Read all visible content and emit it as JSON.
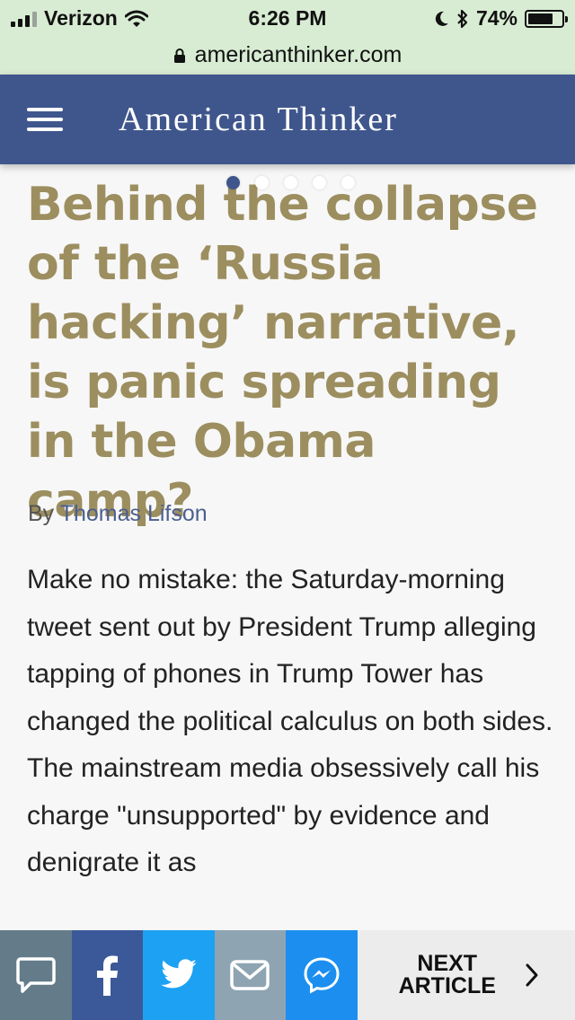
{
  "status_bar": {
    "carrier": "Verizon",
    "time": "6:26 PM",
    "battery_percent": "74%",
    "battery_level": 0.74
  },
  "url_bar": {
    "domain": "americanthinker.com"
  },
  "header": {
    "site_title": "American Thinker"
  },
  "carousel": {
    "dot_count": 5,
    "active_index": 0
  },
  "article": {
    "headline": "Behind the collapse of the ‘Russia hacking’ narrative, is panic spreading in the Obama camp?",
    "byline_prefix": "By",
    "author": "Thomas Lifson",
    "body": "Make no mistake: the Saturday-morning tweet sent out by President Trump alleging tapping of phones in Trump Tower has changed the political calculus on both sides.  The mainstream media obsessively call his charge \"unsupported\" by evidence and denigrate it as"
  },
  "share_bar": {
    "next_article_label": "NEXT ARTICLE",
    "icons": [
      "comment-icon",
      "facebook-icon",
      "twitter-icon",
      "email-icon",
      "messenger-icon",
      "chevron-right-icon"
    ]
  }
}
